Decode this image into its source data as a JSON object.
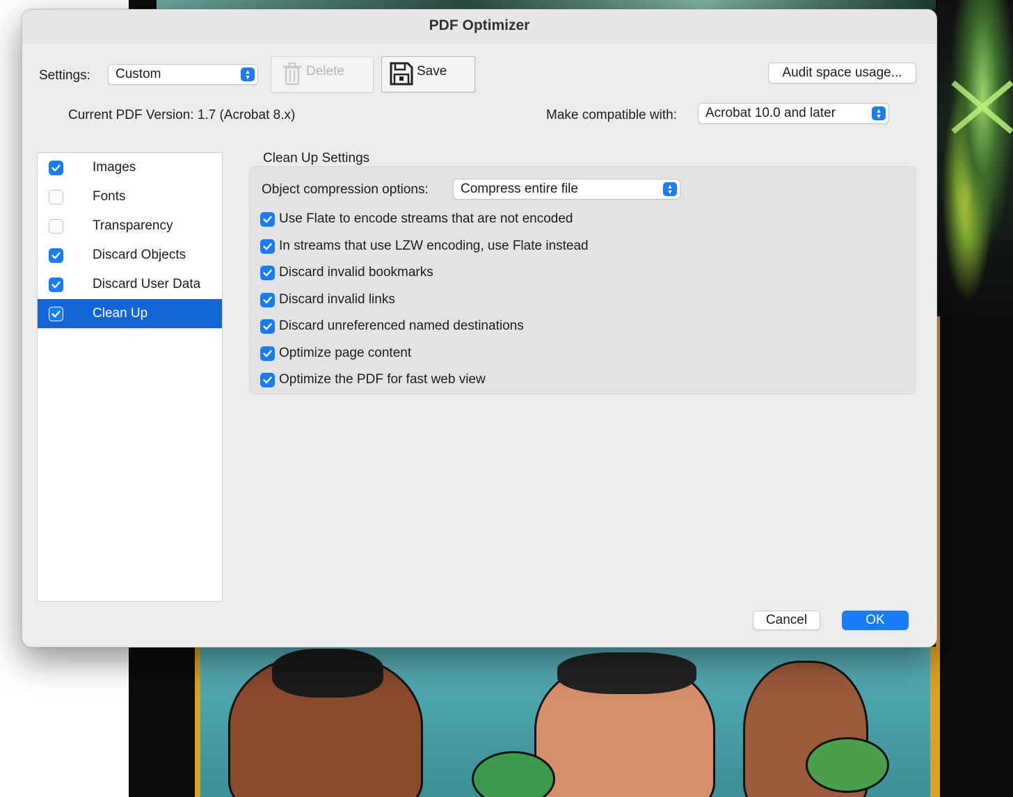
{
  "dialog": {
    "title": "PDF Optimizer"
  },
  "settings": {
    "label": "Settings:",
    "selected": "Custom",
    "delete_label": "Delete",
    "save_label": "Save",
    "audit_label": "Audit space usage..."
  },
  "version": {
    "current_text": "Current PDF Version: 1.7 (Acrobat 8.x)",
    "compat_label": "Make compatible with:",
    "compat_selected": "Acrobat 10.0 and later"
  },
  "sidebar": {
    "items": [
      {
        "label": "Images",
        "checked": true,
        "selected": false
      },
      {
        "label": "Fonts",
        "checked": false,
        "selected": false
      },
      {
        "label": "Transparency",
        "checked": false,
        "selected": false
      },
      {
        "label": "Discard Objects",
        "checked": true,
        "selected": false
      },
      {
        "label": "Discard User Data",
        "checked": true,
        "selected": false
      },
      {
        "label": "Clean Up",
        "checked": true,
        "selected": true
      }
    ]
  },
  "cleanup": {
    "heading": "Clean Up Settings",
    "compression_label": "Object compression options:",
    "compression_selected": "Compress entire file",
    "options": [
      {
        "label": "Use Flate to encode streams that are not encoded",
        "checked": true
      },
      {
        "label": "In streams that use LZW encoding, use Flate instead",
        "checked": true
      },
      {
        "label": "Discard invalid bookmarks",
        "checked": true
      },
      {
        "label": "Discard invalid links",
        "checked": true
      },
      {
        "label": "Discard unreferenced named destinations",
        "checked": true
      },
      {
        "label": "Optimize page content",
        "checked": true
      },
      {
        "label": "Optimize the PDF for fast web view",
        "checked": true
      }
    ]
  },
  "footer": {
    "cancel_label": "Cancel",
    "ok_label": "OK"
  },
  "colors": {
    "accent": "#1a7cf5",
    "selection": "#1565d8"
  }
}
